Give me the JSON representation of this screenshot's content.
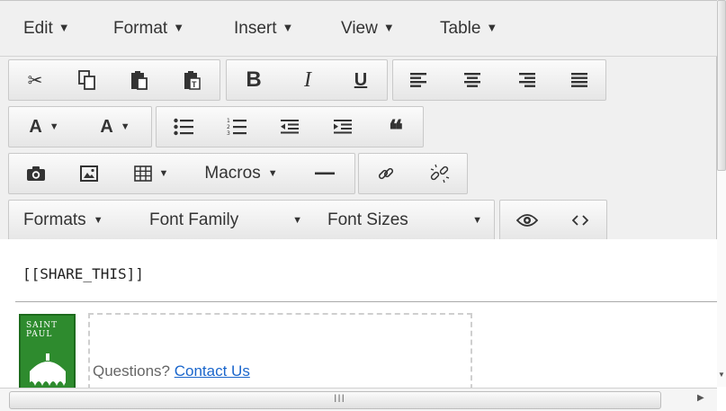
{
  "menubar": {
    "items": [
      {
        "label": "Edit"
      },
      {
        "label": "Format"
      },
      {
        "label": "Insert"
      },
      {
        "label": "View"
      },
      {
        "label": "Table"
      }
    ],
    "caret": "▼"
  },
  "toolbar": {
    "macros_label": "Macros",
    "formats_label": "Formats",
    "font_family_label": "Font Family",
    "font_sizes_label": "Font Sizes",
    "font_color_label": "A",
    "bg_color_label": "A",
    "bold_label": "B",
    "italic_label": "I",
    "underline_label": "U",
    "caret": "▼"
  },
  "content": {
    "share_tag": "[[SHARE_THIS]]",
    "questions_text": "Questions? ",
    "contact_link": "Contact Us",
    "logo_text": "SAINT PAUL"
  },
  "colors": {
    "toolbar_bg": "#f0f0f0",
    "link": "#1a66cc",
    "logo_green": "#2e8b2e"
  }
}
